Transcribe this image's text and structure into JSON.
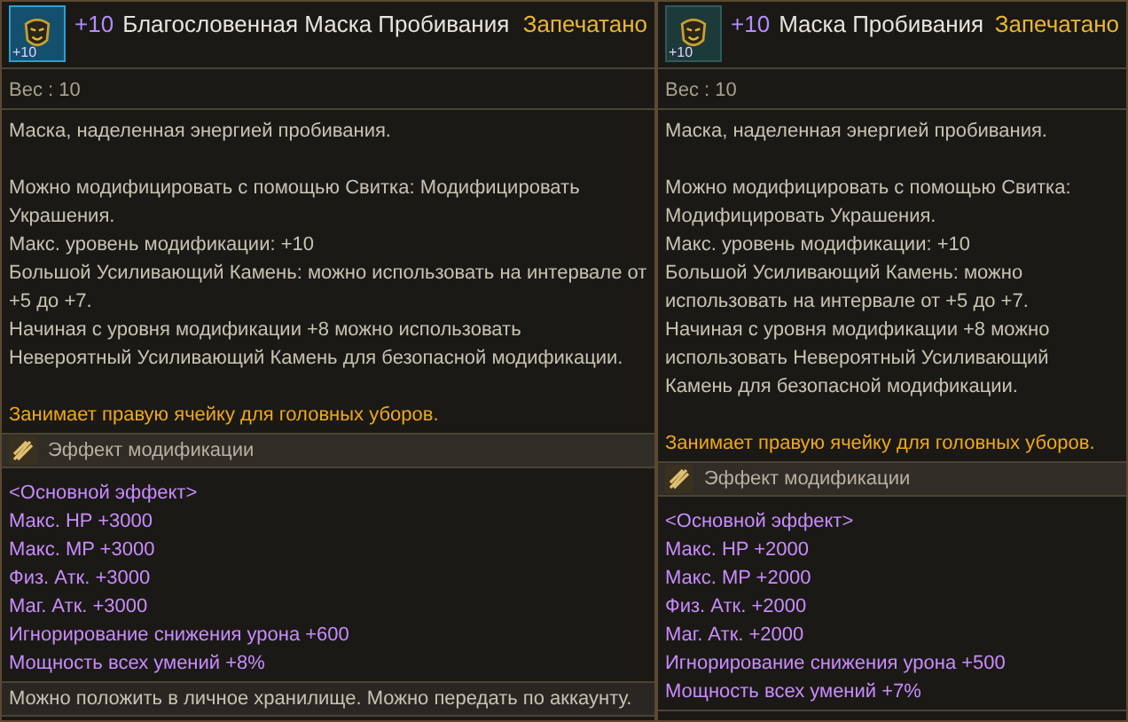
{
  "panels": [
    {
      "icon_badge": "+10",
      "enhance": "+10",
      "name": "Благословенная Маска Пробивания",
      "status": "Запечатано",
      "weight": "Вес : 10",
      "intro": "Маска, наделенная энергией пробивания.",
      "details": [
        "Можно модифицировать с помощью Свитка: Модифицировать Украшения.",
        "Макс. уровень модификации: +10",
        "Большой Усиливающий Камень: можно использовать на интервале от +5 до +7.",
        "Начиная с уровня модификации +8 можно использовать Невероятный Усиливающий Камень для безопасной модификации."
      ],
      "slot_note": "Занимает правую ячейку для головных уборов.",
      "effect_header": "Эффект модификации",
      "effects": [
        "<Основной эффект>",
        "Макс. HP +3000",
        "Макс. MP +3000",
        "Физ. Атк. +3000",
        "Маг. Атк. +3000",
        "Игнорирование снижения урона +600",
        "Мощность всех умений +8%"
      ],
      "footer": "Можно положить в личное хранилище. Можно передать по аккаунту."
    },
    {
      "icon_badge": "+10",
      "enhance": "+10",
      "name": "Маска Пробивания",
      "status": "Запечатано",
      "weight": "Вес : 10",
      "intro": "Маска, наделенная энергией пробивания.",
      "details": [
        "Можно модифицировать с помощью Свитка: Модифицировать Украшения.",
        "Макс. уровень модификации: +10",
        "Большой Усиливающий Камень: можно использовать на интервале от +5 до +7.",
        "Начиная с уровня модификации +8 можно использовать Невероятный Усиливающий Камень для безопасной модификации."
      ],
      "slot_note": "Занимает правую ячейку для головных уборов.",
      "effect_header": "Эффект модификации",
      "effects": [
        "<Основной эффект>",
        "Макс. HP +2000",
        "Макс. MP +2000",
        "Физ. Атк. +2000",
        "Маг. Атк. +2000",
        "Игнорирование снижения урона +500",
        "Мощность всех умений +7%"
      ]
    }
  ]
}
